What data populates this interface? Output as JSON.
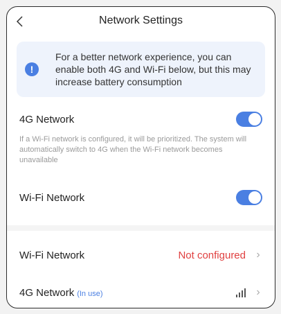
{
  "header": {
    "title": "Network Settings"
  },
  "info_banner": {
    "text": "For a better network experience, you can enable both 4G and Wi-Fi below, but this may increase battery consumption"
  },
  "toggles": {
    "fourg": {
      "label": "4G Network",
      "enabled": true
    },
    "wifi": {
      "label": "Wi-Fi Network",
      "enabled": true
    }
  },
  "description": "If a Wi-Fi network is configured, it will be prioritized. The system will automatically switch to 4G when the Wi-Fi network becomes unavailable",
  "nav": {
    "wifi": {
      "label": "Wi-Fi Network",
      "status": "Not configured"
    },
    "fourg": {
      "label": "4G Network",
      "tag": "(In use)"
    }
  },
  "colors": {
    "accent": "#4a7fe2",
    "status_error": "#e04040"
  },
  "icons": {
    "back": "chevron-left-icon",
    "info": "info-icon",
    "signal": "signal-strength-icon",
    "chevron": "chevron-right-icon"
  }
}
